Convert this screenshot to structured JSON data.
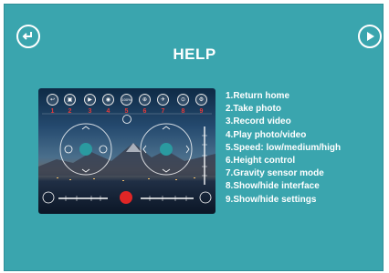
{
  "header": {
    "title": "HELP",
    "back_icon": "return-arrow-icon",
    "next_icon": "play-triangle-icon"
  },
  "preview": {
    "toolbar": [
      {
        "num": "1",
        "icon": "return-icon",
        "glyph": "↩"
      },
      {
        "num": "2",
        "icon": "camera-icon",
        "glyph": "▣"
      },
      {
        "num": "3",
        "icon": "video-icon",
        "glyph": "▶"
      },
      {
        "num": "4",
        "icon": "play-icon",
        "glyph": "◉"
      },
      {
        "num": "5",
        "icon": "speed-icon",
        "glyph": "100%"
      },
      {
        "num": "6",
        "icon": "height-icon",
        "glyph": "⊕"
      },
      {
        "num": "7",
        "icon": "gravity-icon",
        "glyph": "✈"
      },
      {
        "num": "8",
        "icon": "interface-icon",
        "glyph": "⊙"
      },
      {
        "num": "9",
        "icon": "settings-icon",
        "glyph": "⚙"
      }
    ]
  },
  "help_items": [
    "1.Return home",
    "2.Take photo",
    "3.Record video",
    "4.Play photo/video",
    "5.Speed: low/medium/high",
    "6.Height control",
    "7.Gravity sensor mode",
    "8.Show/hide interface",
    "9.Show/hide settings"
  ],
  "colors": {
    "background": "#3aa5ae",
    "accent_number": "#e53b3b",
    "joystick": "#2a9aa0",
    "record_button": "#e02626"
  }
}
